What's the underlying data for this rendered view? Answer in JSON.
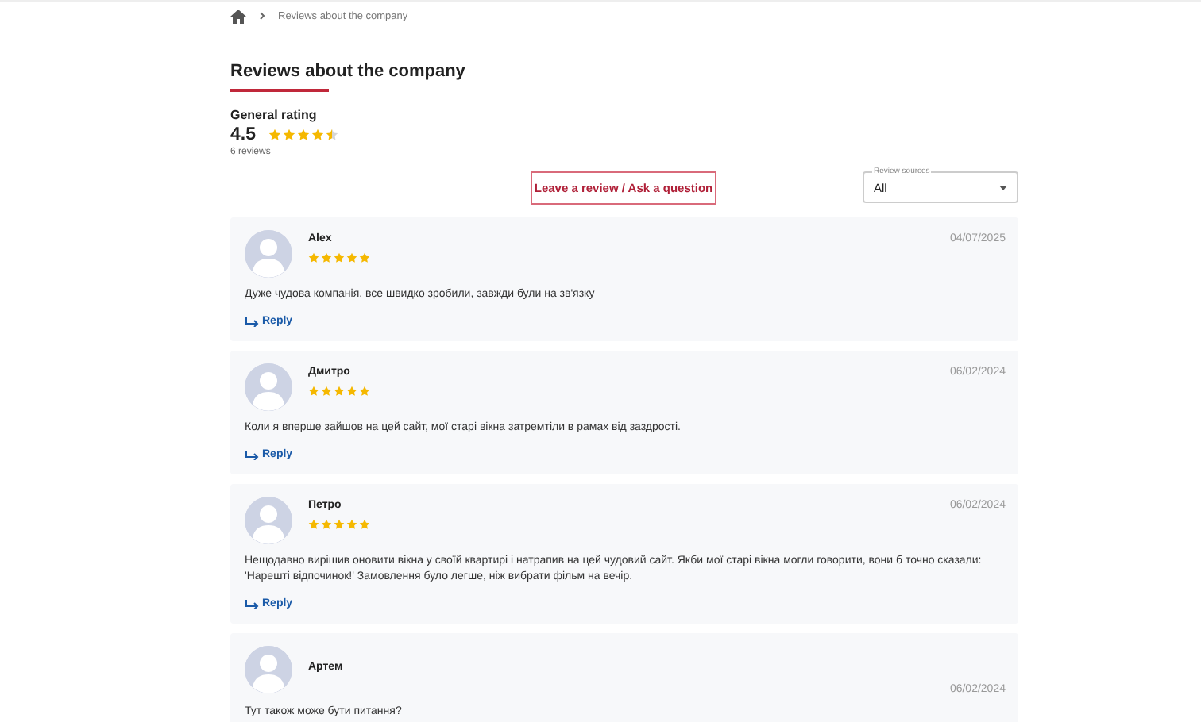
{
  "breadcrumb": {
    "current": "Reviews about the company"
  },
  "heading": "Reviews about the company",
  "rating": {
    "label": "General rating",
    "value": "4.5",
    "stars": 4.5,
    "count": "6 reviews"
  },
  "leave_review_button": "Leave a review / Ask a question",
  "review_sources": {
    "label": "Review sources",
    "value": "All"
  },
  "reviews": [
    {
      "author": "Alex",
      "stars": 5,
      "date": "04/07/2025",
      "text": "Дуже чудова компанія, все швидко зробили, завжди були на зв'язку",
      "reply": "Reply"
    },
    {
      "author": "Дмитро",
      "stars": 5,
      "date": "06/02/2024",
      "text": "Коли я вперше зайшов на цей сайт, мої старі вікна затремтіли в рамах від заздрості.",
      "reply": "Reply"
    },
    {
      "author": "Петро",
      "stars": 5,
      "date": "06/02/2024",
      "text": "Нещодавно вирішив оновити вікна у своїй квартирі і натрапив на цей чудовий сайт. Якби мої старі вікна могли говорити, вони б точно сказали: 'Нарешті відпочинок!' Замовлення було легше, ніж вибрати фільм на вечір.",
      "reply": "Reply"
    },
    {
      "author": "Артем",
      "date": "06/02/2024",
      "text": "Тут також може бути питання?"
    }
  ]
}
